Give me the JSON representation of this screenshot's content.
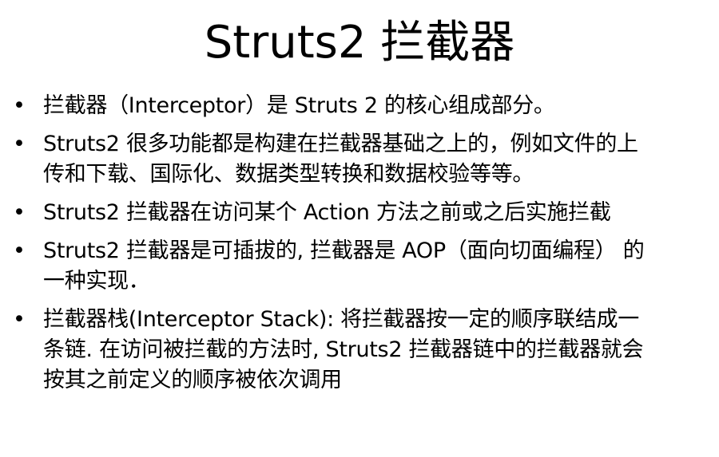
{
  "slide": {
    "title": "Struts2 拦截器",
    "bullets": [
      {
        "lines": [
          "拦截器（Interceptor）是 Struts 2 的核心组成部分。"
        ]
      },
      {
        "lines": [
          "Struts2 很多功能都是构建在拦截器基础之上的，例如文件的上",
          "传和下载、国际化、数据类型转换和数据校验等等。"
        ]
      },
      {
        "lines": [
          "Struts2 拦截器在访问某个 Action 方法之前或之后实施拦截"
        ]
      },
      {
        "lines": [
          "Struts2 拦截器是可插拔的, 拦截器是 AOP（面向切面编程） 的",
          "一种实现．"
        ]
      },
      {
        "lines": [
          "拦截器栈(Interceptor Stack): 将拦截器按一定的顺序联结成一",
          "条链. 在访问被拦截的方法时, Struts2 拦截器链中的拦截器就会",
          "按其之前定义的顺序被依次调用"
        ]
      }
    ],
    "bullet_symbol": "•"
  }
}
